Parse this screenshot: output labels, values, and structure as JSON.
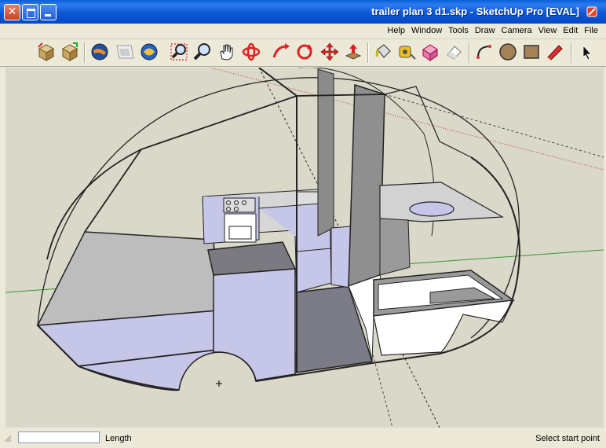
{
  "window": {
    "title": "trailer plan 3 d1.skp - SketchUp Pro [EVAL]",
    "close_glyph": "✕"
  },
  "menubar": {
    "items": [
      "File",
      "Edit",
      "View",
      "Camera",
      "Draw",
      "Tools",
      "Window",
      "Help"
    ]
  },
  "toolbar": {
    "tools": [
      {
        "name": "select-icon"
      },
      {
        "name": "line-icon"
      },
      {
        "name": "arc-icon"
      },
      {
        "name": "circle-icon"
      },
      {
        "name": "rectangle-icon"
      },
      {
        "name": "pencil-icon"
      },
      {
        "name": "eraser-icon"
      },
      {
        "name": "make-component-icon"
      },
      {
        "name": "tape-measure-icon"
      },
      {
        "name": "paint-bucket-icon"
      },
      {
        "name": "push-pull-icon"
      },
      {
        "name": "move-icon"
      },
      {
        "name": "rotate-icon"
      },
      {
        "name": "follow-me-icon"
      },
      {
        "name": "orbit-icon"
      },
      {
        "name": "pan-icon"
      },
      {
        "name": "zoom-icon"
      },
      {
        "name": "zoom-window-icon"
      },
      {
        "name": "zoom-extents-icon"
      },
      {
        "name": "previous-view-icon"
      },
      {
        "name": "get-models-icon"
      },
      {
        "name": "share-model-icon"
      },
      {
        "name": "share-component-icon"
      },
      {
        "name": "google-earth-icon"
      }
    ]
  },
  "statusbar": {
    "status": "Select start point",
    "vcb_label": "Length",
    "vcb_value": ""
  },
  "colors": {
    "titlebar": "#0a5fd9",
    "sky": "#dad8c8",
    "ground": "#dad8c8",
    "face_front": "#c5c8e6",
    "face_dark": "#808080",
    "face_gray": "#b5b5b5",
    "face_white": "#ffffff"
  }
}
